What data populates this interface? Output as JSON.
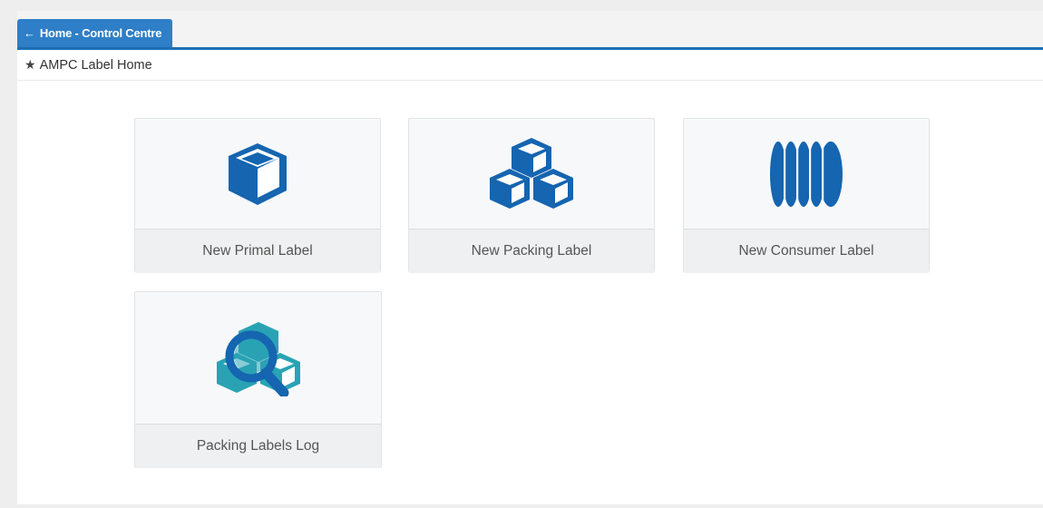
{
  "header": {
    "back_tab_label": "Home - Control Centre",
    "back_icon": "arrow-left-icon"
  },
  "breadcrumb": {
    "icon": "star-icon",
    "title": "AMPC Label Home"
  },
  "tiles": [
    {
      "label": "New Primal Label",
      "icon": "cube-icon"
    },
    {
      "label": "New Packing Label",
      "icon": "cubes-icon"
    },
    {
      "label": "New Consumer Label",
      "icon": "stacked-discs-icon"
    },
    {
      "label": "Packing Labels Log",
      "icon": "cubes-search-icon"
    }
  ],
  "colors": {
    "accent": "#1d6fb5",
    "tab": "#2e7fc7",
    "icon_blue": "#1565b0",
    "icon_teal": "#29a3b4"
  }
}
